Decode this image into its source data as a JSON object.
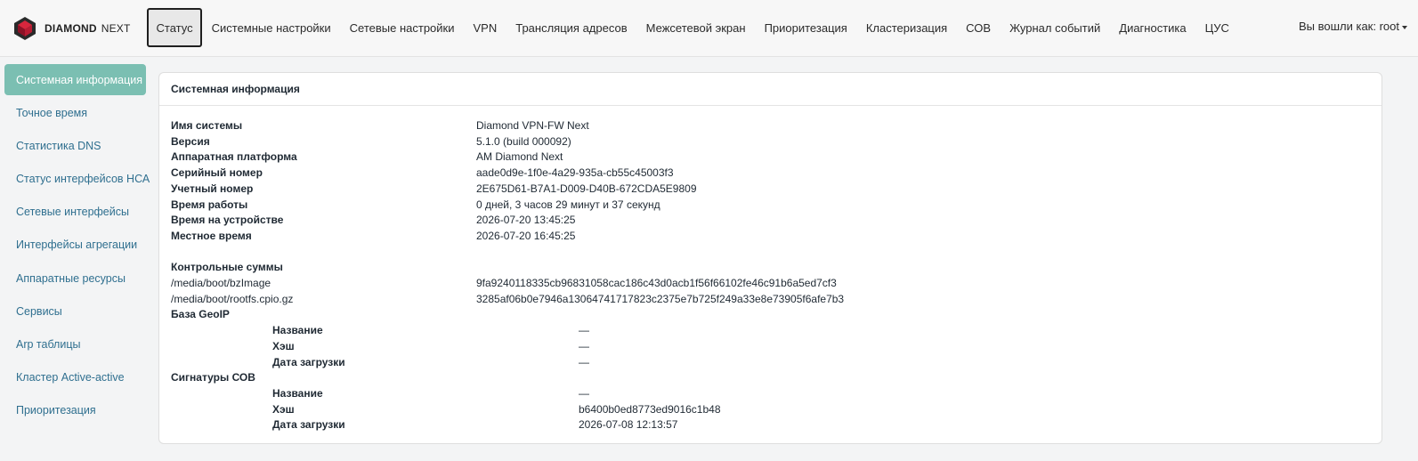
{
  "brand": {
    "name": "DIAMOND",
    "suffix": "NEXT"
  },
  "nav": [
    "Статус",
    "Системные настройки",
    "Сетевые настройки",
    "VPN",
    "Трансляция адресов",
    "Межсетевой экран",
    "Приоритезация",
    "Кластеризация",
    "СОВ",
    "Журнал событий",
    "Диагностика",
    "ЦУС"
  ],
  "nav_active": 0,
  "user": {
    "label": "Вы вошли как: root"
  },
  "sidebar": [
    "Системная информация",
    "Точное время",
    "Статистика DNS",
    "Статус интерфейсов НСА",
    "Сетевые интерфейсы",
    "Интерфейсы агрегации",
    "Аппаратные ресурсы",
    "Сервисы",
    "Arp таблицы",
    "Кластер Active-active",
    "Приоритезация"
  ],
  "sidebar_active": 0,
  "panel": {
    "title": "Системная информация",
    "info": [
      {
        "label": "Имя системы",
        "value": "Diamond VPN-FW Next"
      },
      {
        "label": "Версия",
        "value": "5.1.0 (build 000092)"
      },
      {
        "label": "Аппаратная платформа",
        "value": "AM Diamond Next"
      },
      {
        "label": "Серийный номер",
        "value": "aade0d9e-1f0e-4a29-935a-cb55c45003f3"
      },
      {
        "label": "Учетный номер",
        "value": "2E675D61-B7A1-D009-D40B-672CDA5E9809"
      },
      {
        "label": "Время работы",
        "value": "0 дней, 3 часов 29 минут и 37 секунд"
      },
      {
        "label": "Время на устройстве",
        "value": "2026-07-20 13:45:25"
      },
      {
        "label": "Местное время",
        "value": "2026-07-20 16:45:25"
      }
    ],
    "checksums": {
      "title": "Контрольные суммы",
      "files": [
        {
          "path": "/media/boot/bzImage",
          "hash": "9fa9240118335cb96831058cac186c43d0acb1f56f66102fe46c91b6a5ed7cf3"
        },
        {
          "path": "/media/boot/rootfs.cpio.gz",
          "hash": "3285af06b0e7946a13064741717823c2375e7b725f249a33e8e73905f6afe7b3"
        }
      ]
    },
    "geoip": {
      "title": "База GeoIP",
      "rows": [
        {
          "label": "Название",
          "value": "—"
        },
        {
          "label": "Хэш",
          "value": "—"
        },
        {
          "label": "Дата загрузки",
          "value": "—"
        }
      ]
    },
    "ids": {
      "title": "Сигнатуры СОВ",
      "rows": [
        {
          "label": "Название",
          "value": "—"
        },
        {
          "label": "Хэш",
          "value": "b6400b0ed8773ed9016c1b48"
        },
        {
          "label": "Дата загрузки",
          "value": "2026-07-08 12:13:57"
        }
      ]
    }
  }
}
